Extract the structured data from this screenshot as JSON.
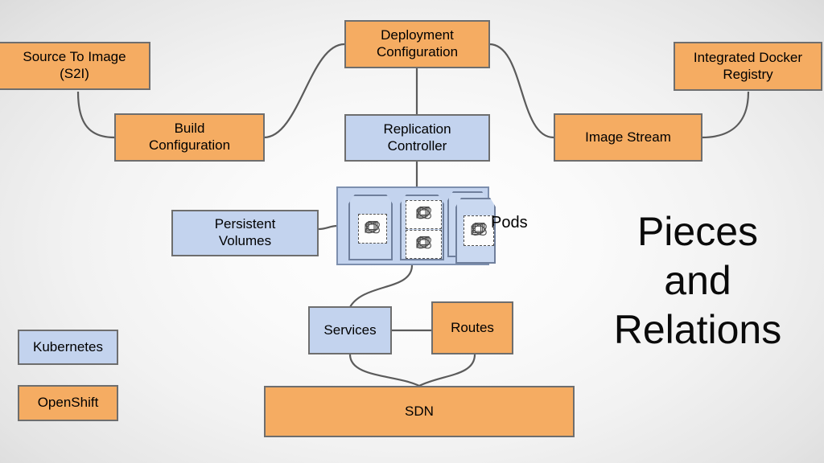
{
  "title": {
    "lines": [
      "Pieces",
      "and",
      "Relations"
    ]
  },
  "colors": {
    "openshift_fill": "#f5ac62",
    "kubernetes_fill": "#c3d3ee",
    "node_border": "#6e6e6e",
    "connector": "#5b5b5b",
    "pod_container_fill": "#c3d3ee",
    "pod_shape_fill": "#c9d8f0",
    "background_center": "#ffffff",
    "background_edge": "#d2d2d2"
  },
  "nodes": {
    "source_to_image": {
      "line1": "Source To Image",
      "line2": "(S2I)",
      "type": "openshift"
    },
    "build_configuration": {
      "line1": "Build",
      "line2": "Configuration",
      "type": "openshift"
    },
    "deployment_configuration": {
      "line1": "Deployment",
      "line2": "Configuration",
      "type": "openshift"
    },
    "replication_controller": {
      "line1": "Replication",
      "line2": "Controller",
      "type": "kubernetes"
    },
    "image_stream": {
      "line1": "Image Stream",
      "type": "openshift"
    },
    "integrated_docker_registry": {
      "line1": "Integrated Docker",
      "line2": "Registry",
      "type": "openshift"
    },
    "persistent_volumes": {
      "line1": "Persistent",
      "line2": "Volumes",
      "type": "kubernetes"
    },
    "services": {
      "line1": "Services",
      "type": "kubernetes"
    },
    "routes": {
      "line1": "Routes",
      "type": "openshift"
    },
    "sdn": {
      "line1": "SDN",
      "type": "openshift"
    }
  },
  "pods": {
    "group_label": "Pods",
    "icon_name": "container-icon",
    "pod_count": 3,
    "containers_per_pod": [
      1,
      2,
      1
    ]
  },
  "legend": {
    "items": [
      {
        "label": "Kubernetes",
        "type": "kubernetes",
        "color": "#c3d3ee"
      },
      {
        "label": "OpenShift",
        "type": "openshift",
        "color": "#f5ac62"
      }
    ]
  },
  "connections": [
    {
      "from": "source_to_image",
      "to": "build_configuration"
    },
    {
      "from": "build_configuration",
      "to": "deployment_configuration"
    },
    {
      "from": "deployment_configuration",
      "to": "replication_controller"
    },
    {
      "from": "deployment_configuration",
      "to": "image_stream"
    },
    {
      "from": "image_stream",
      "to": "integrated_docker_registry"
    },
    {
      "from": "replication_controller",
      "to": "pods"
    },
    {
      "from": "persistent_volumes",
      "to": "pods"
    },
    {
      "from": "pods",
      "to": "services"
    },
    {
      "from": "services",
      "to": "routes"
    },
    {
      "from": "services",
      "to": "sdn"
    },
    {
      "from": "routes",
      "to": "sdn"
    }
  ]
}
